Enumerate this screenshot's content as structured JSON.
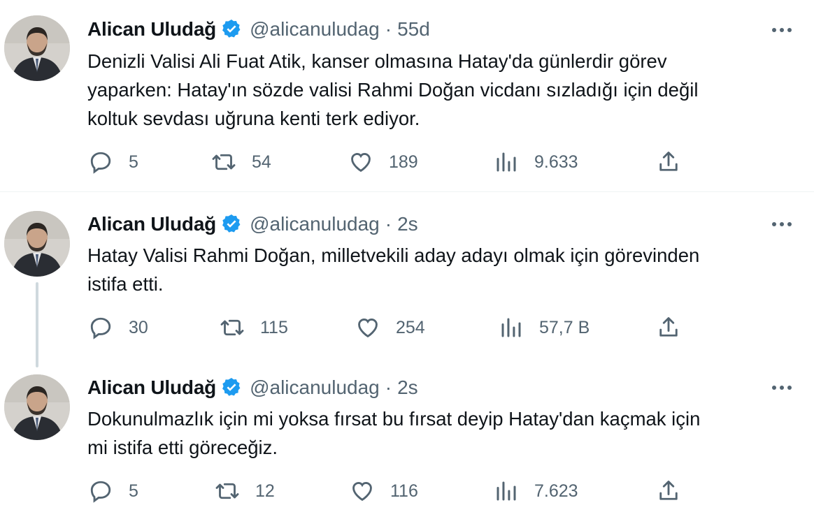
{
  "tweets": [
    {
      "name": "Alican Uludağ",
      "handle": "@alicanuludag",
      "separator": "·",
      "time": "55d",
      "text": "Denizli Valisi Ali Fuat Atik, kanser olmasına Hatay'da günlerdir görev\nyaparken: Hatay'ın sözde valisi Rahmi Doğan vicdanı sızladığı için değil\nkoltuk sevdası uğruna kenti terk ediyor.",
      "replies": "5",
      "retweets": "54",
      "likes": "189",
      "views": "9.633"
    },
    {
      "name": "Alican Uludağ",
      "handle": "@alicanuludag",
      "separator": "·",
      "time": "2s",
      "text": "Hatay Valisi Rahmi Doğan, milletvekili aday adayı olmak için görevinden\nistifa etti.",
      "replies": "30",
      "retweets": "115",
      "likes": "254",
      "views": "57,7 B"
    },
    {
      "name": "Alican Uludağ",
      "handle": "@alicanuludag",
      "separator": "·",
      "time": "2s",
      "text": "Dokunulmazlık için mi yoksa fırsat bu fırsat deyip Hatay'dan kaçmak için\nmi istifa etti göreceğiz.",
      "replies": "5",
      "retweets": "12",
      "likes": "116",
      "views": "7.623"
    }
  ],
  "icons": {
    "verified": "verified-badge-icon",
    "more": "more-horizontal-icon",
    "reply": "reply-icon",
    "retweet": "retweet-icon",
    "like": "heart-icon",
    "views": "views-chart-icon",
    "share": "share-icon"
  },
  "colors": {
    "text": "#0f1419",
    "secondary": "#536471",
    "verified": "#1d9bf0",
    "divider": "#eff3f4",
    "thread_line": "#cfd9de"
  }
}
